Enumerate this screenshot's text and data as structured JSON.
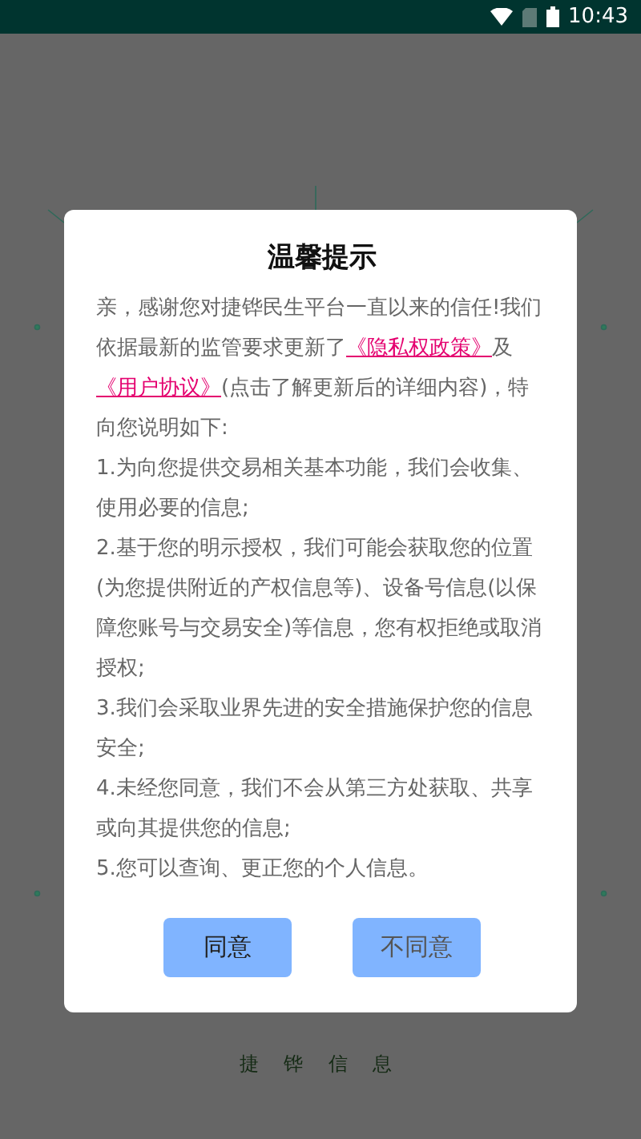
{
  "status_bar": {
    "time": "10:43"
  },
  "dialog": {
    "title": "温馨提示",
    "intro": {
      "before": "亲，感谢您对捷铧民生平台一直以来的信任!我们依据最新的监管要求更新了",
      "links": [
        {
          "text": "《隐私权政策》",
          "after": "及"
        },
        {
          "text": "《用户协议》",
          "after": "(点击了解更新后的详细内容)，特向您说明如下:"
        }
      ]
    },
    "items": [
      "1.为向您提供交易相关基本功能，我们会收集、使用必要的信息;",
      "2.基于您的明示授权，我们可能会获取您的位置(为您提供附近的产权信息等)、设备号信息(以保障您账号与交易安全)等信息，您有权拒绝或取消授权;",
      "3.我们会采取业界先进的安全措施保护您的信息安全;",
      "4.未经您同意，我们不会从第三方处获取、共享或向其提供您的信息;",
      "5.您可以查询、更正您的个人信息。"
    ],
    "buttons": [
      {
        "label": "同意",
        "kind": "primary"
      },
      {
        "label": "不同意",
        "kind": "secondary"
      }
    ]
  },
  "footer": {
    "brand": "捷 铧 信 息"
  }
}
